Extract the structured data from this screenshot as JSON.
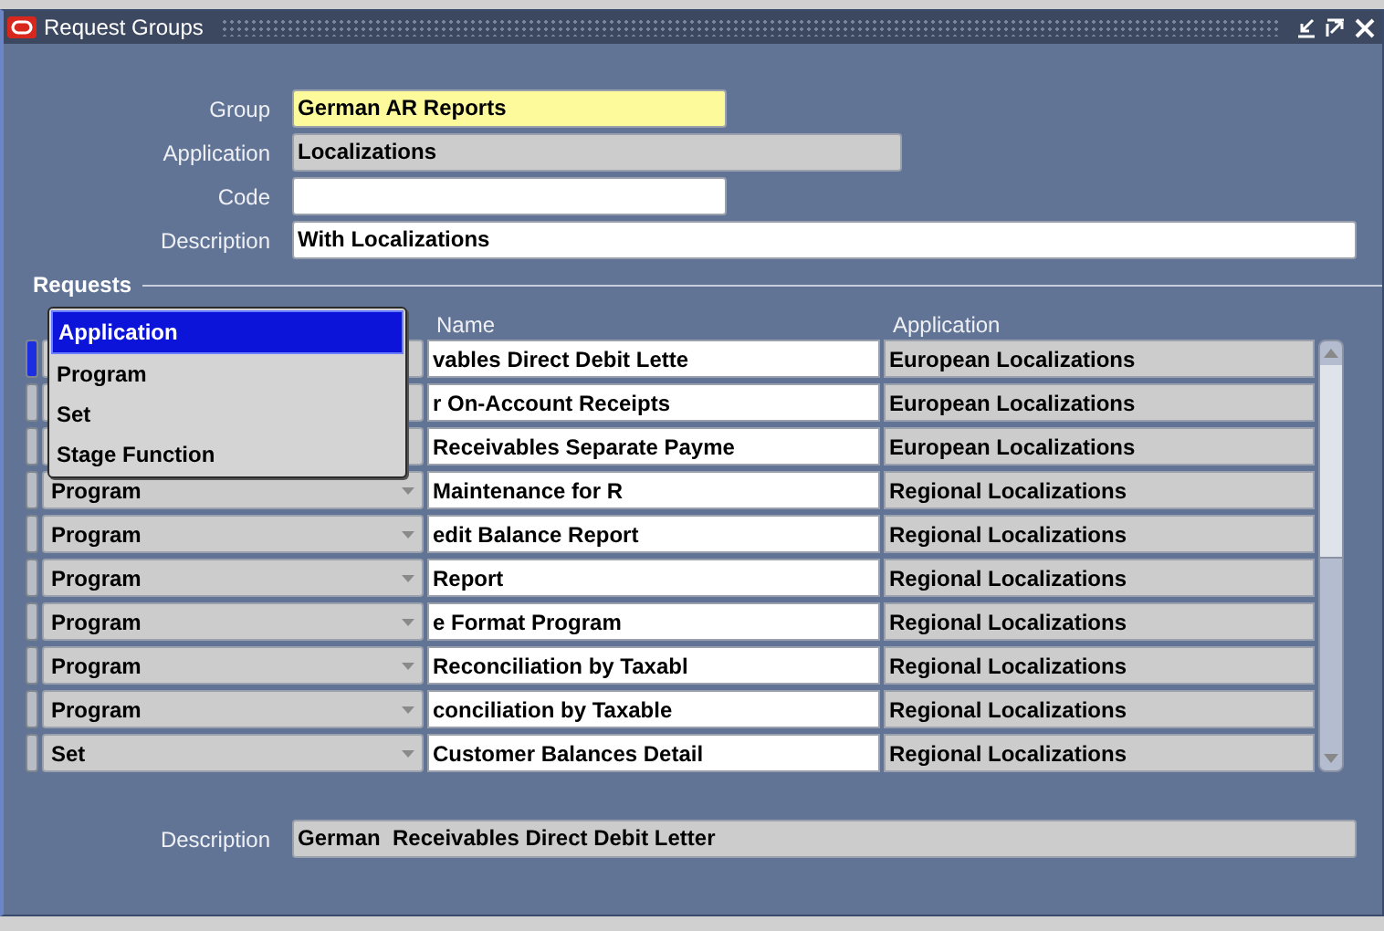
{
  "window": {
    "title": "Request Groups"
  },
  "header_fields": [
    {
      "label": "Group",
      "value": "German AR Reports",
      "kind": "required"
    },
    {
      "label": "Application",
      "value": "Localizations",
      "kind": "readonly"
    },
    {
      "label": "Code",
      "kind": "normal"
    },
    {
      "label": "Description",
      "value": "With Localizations",
      "kind": "normal"
    }
  ],
  "requests": {
    "title": "Requests",
    "columns": [
      "Name",
      "Application"
    ],
    "rows": [
      {
        "current": true,
        "name": "vables Direct Debit Lette",
        "application": "European Localizations"
      },
      {
        "current": false,
        "name": "r On-Account Receipts",
        "application": "European Localizations"
      },
      {
        "current": false,
        "name": "Receivables Separate Payme",
        "application": "European Localizations"
      },
      {
        "current": false,
        "type": "Program",
        "name": "Maintenance for R",
        "application": "Regional Localizations"
      },
      {
        "current": false,
        "type": "Program",
        "name": "edit Balance Report",
        "application": "Regional Localizations"
      },
      {
        "current": false,
        "type": "Program",
        "name": "Report",
        "application": "Regional Localizations"
      },
      {
        "current": false,
        "type": "Program",
        "name": "e Format Program",
        "application": "Regional Localizations"
      },
      {
        "current": false,
        "type": "Program",
        "name": "Reconciliation by Taxabl",
        "application": "Regional Localizations"
      },
      {
        "current": false,
        "type": "Program",
        "name": "conciliation by Taxable",
        "application": "Regional Localizations"
      },
      {
        "current": false,
        "type": "Set",
        "name": "Customer Balances Detail",
        "application": "Regional Localizations"
      }
    ],
    "type_dropdown": [
      {
        "label": "Application",
        "selected": true
      },
      {
        "label": "Program",
        "selected": false
      },
      {
        "label": "Set",
        "selected": false
      },
      {
        "label": "Stage Function",
        "selected": false
      }
    ]
  },
  "footer": {
    "label": "Description",
    "value": "German  Receivables Direct Debit Letter"
  }
}
